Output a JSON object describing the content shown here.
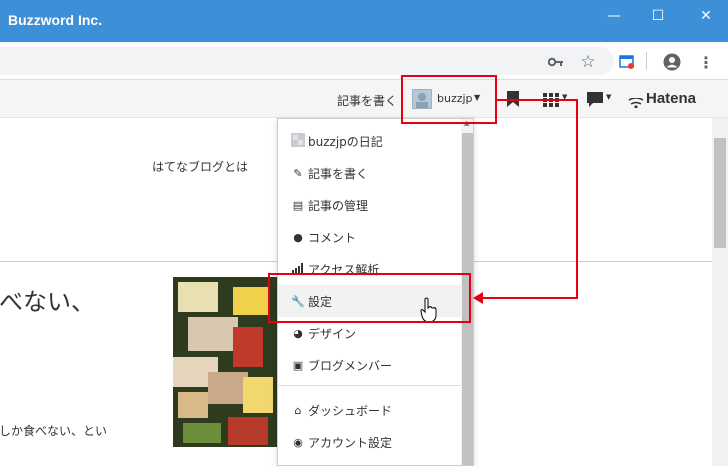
{
  "window": {
    "title": "Buzzword Inc.",
    "minimize": "—",
    "maximize": "☐",
    "close": "✕"
  },
  "toolbar": {
    "icons": [
      "key-icon",
      "star-icon",
      "cast-icon",
      "account-icon",
      "menu-icon"
    ]
  },
  "hatena_bar": {
    "write_link": "記事を書く",
    "user_name": "buzzjp",
    "brand": "Hatena",
    "colors": {
      "highlight": "#e60012",
      "bar_bg": "#f5f5f5"
    }
  },
  "content": {
    "about_link": "はてなブログとは",
    "heading_fragment": "べない、",
    "body_fragment": "しか食べない、とい"
  },
  "dropdown": {
    "items": [
      {
        "label": "buzzjpの日記",
        "icon": "blog-thumbnail-icon"
      },
      {
        "label": "記事を書く",
        "icon": "edit-icon"
      },
      {
        "label": "記事の管理",
        "icon": "document-icon"
      },
      {
        "label": "コメント",
        "icon": "comment-icon"
      },
      {
        "label": "アクセス解析",
        "icon": "bar-chart-icon"
      },
      {
        "label": "設定",
        "icon": "wrench-icon"
      },
      {
        "label": "デザイン",
        "icon": "palette-icon"
      },
      {
        "label": "ブログメンバー",
        "icon": "member-card-icon"
      },
      {
        "label": "ダッシュボード",
        "icon": "home-icon"
      },
      {
        "label": "アカウント設定",
        "icon": "user-circle-icon"
      }
    ]
  }
}
